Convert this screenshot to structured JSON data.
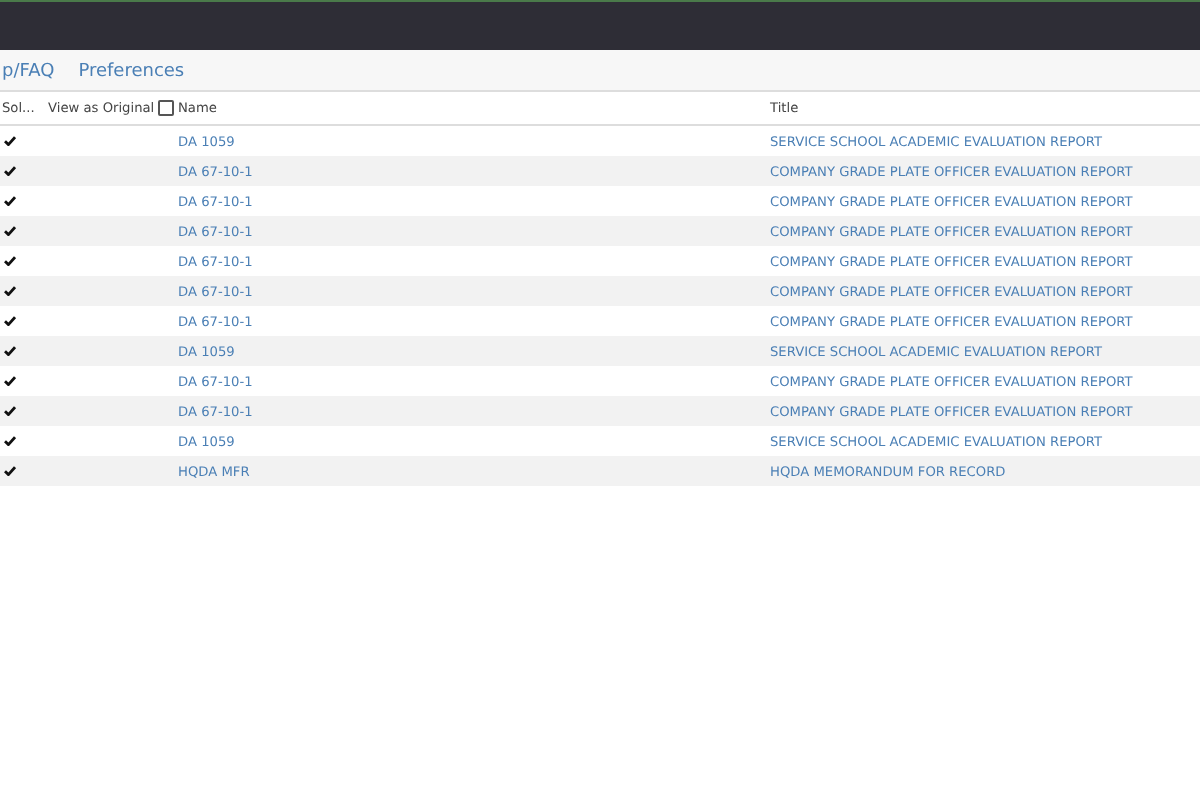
{
  "nav": {
    "links": [
      "p/FAQ",
      "Preferences"
    ]
  },
  "table": {
    "columns": [
      {
        "label": "Sol..."
      },
      {
        "label": "View as Original",
        "checkbox": {
          "checked": false
        }
      },
      {
        "label": "Name"
      },
      {
        "label": "Title"
      }
    ],
    "rows": [
      {
        "checked": true,
        "name": "DA 1059",
        "title": "SERVICE SCHOOL ACADEMIC EVALUATION REPORT"
      },
      {
        "checked": true,
        "name": "DA 67-10-1",
        "title": "COMPANY GRADE PLATE OFFICER EVALUATION REPORT"
      },
      {
        "checked": true,
        "name": "DA 67-10-1",
        "title": "COMPANY GRADE PLATE OFFICER EVALUATION REPORT"
      },
      {
        "checked": true,
        "name": "DA 67-10-1",
        "title": "COMPANY GRADE PLATE OFFICER EVALUATION REPORT"
      },
      {
        "checked": true,
        "name": "DA 67-10-1",
        "title": "COMPANY GRADE PLATE OFFICER EVALUATION REPORT"
      },
      {
        "checked": true,
        "name": "DA 67-10-1",
        "title": "COMPANY GRADE PLATE OFFICER EVALUATION REPORT"
      },
      {
        "checked": true,
        "name": "DA 67-10-1",
        "title": "COMPANY GRADE PLATE OFFICER EVALUATION REPORT"
      },
      {
        "checked": true,
        "name": "DA 1059",
        "title": "SERVICE SCHOOL ACADEMIC EVALUATION REPORT"
      },
      {
        "checked": true,
        "name": "DA 67-10-1",
        "title": "COMPANY GRADE PLATE OFFICER EVALUATION REPORT"
      },
      {
        "checked": true,
        "name": "DA 67-10-1",
        "title": "COMPANY GRADE PLATE OFFICER EVALUATION REPORT"
      },
      {
        "checked": true,
        "name": "DA 1059",
        "title": "SERVICE SCHOOL ACADEMIC EVALUATION REPORT"
      },
      {
        "checked": true,
        "name": "HQDA MFR",
        "title": "HQDA MEMORANDUM FOR RECORD"
      }
    ]
  }
}
